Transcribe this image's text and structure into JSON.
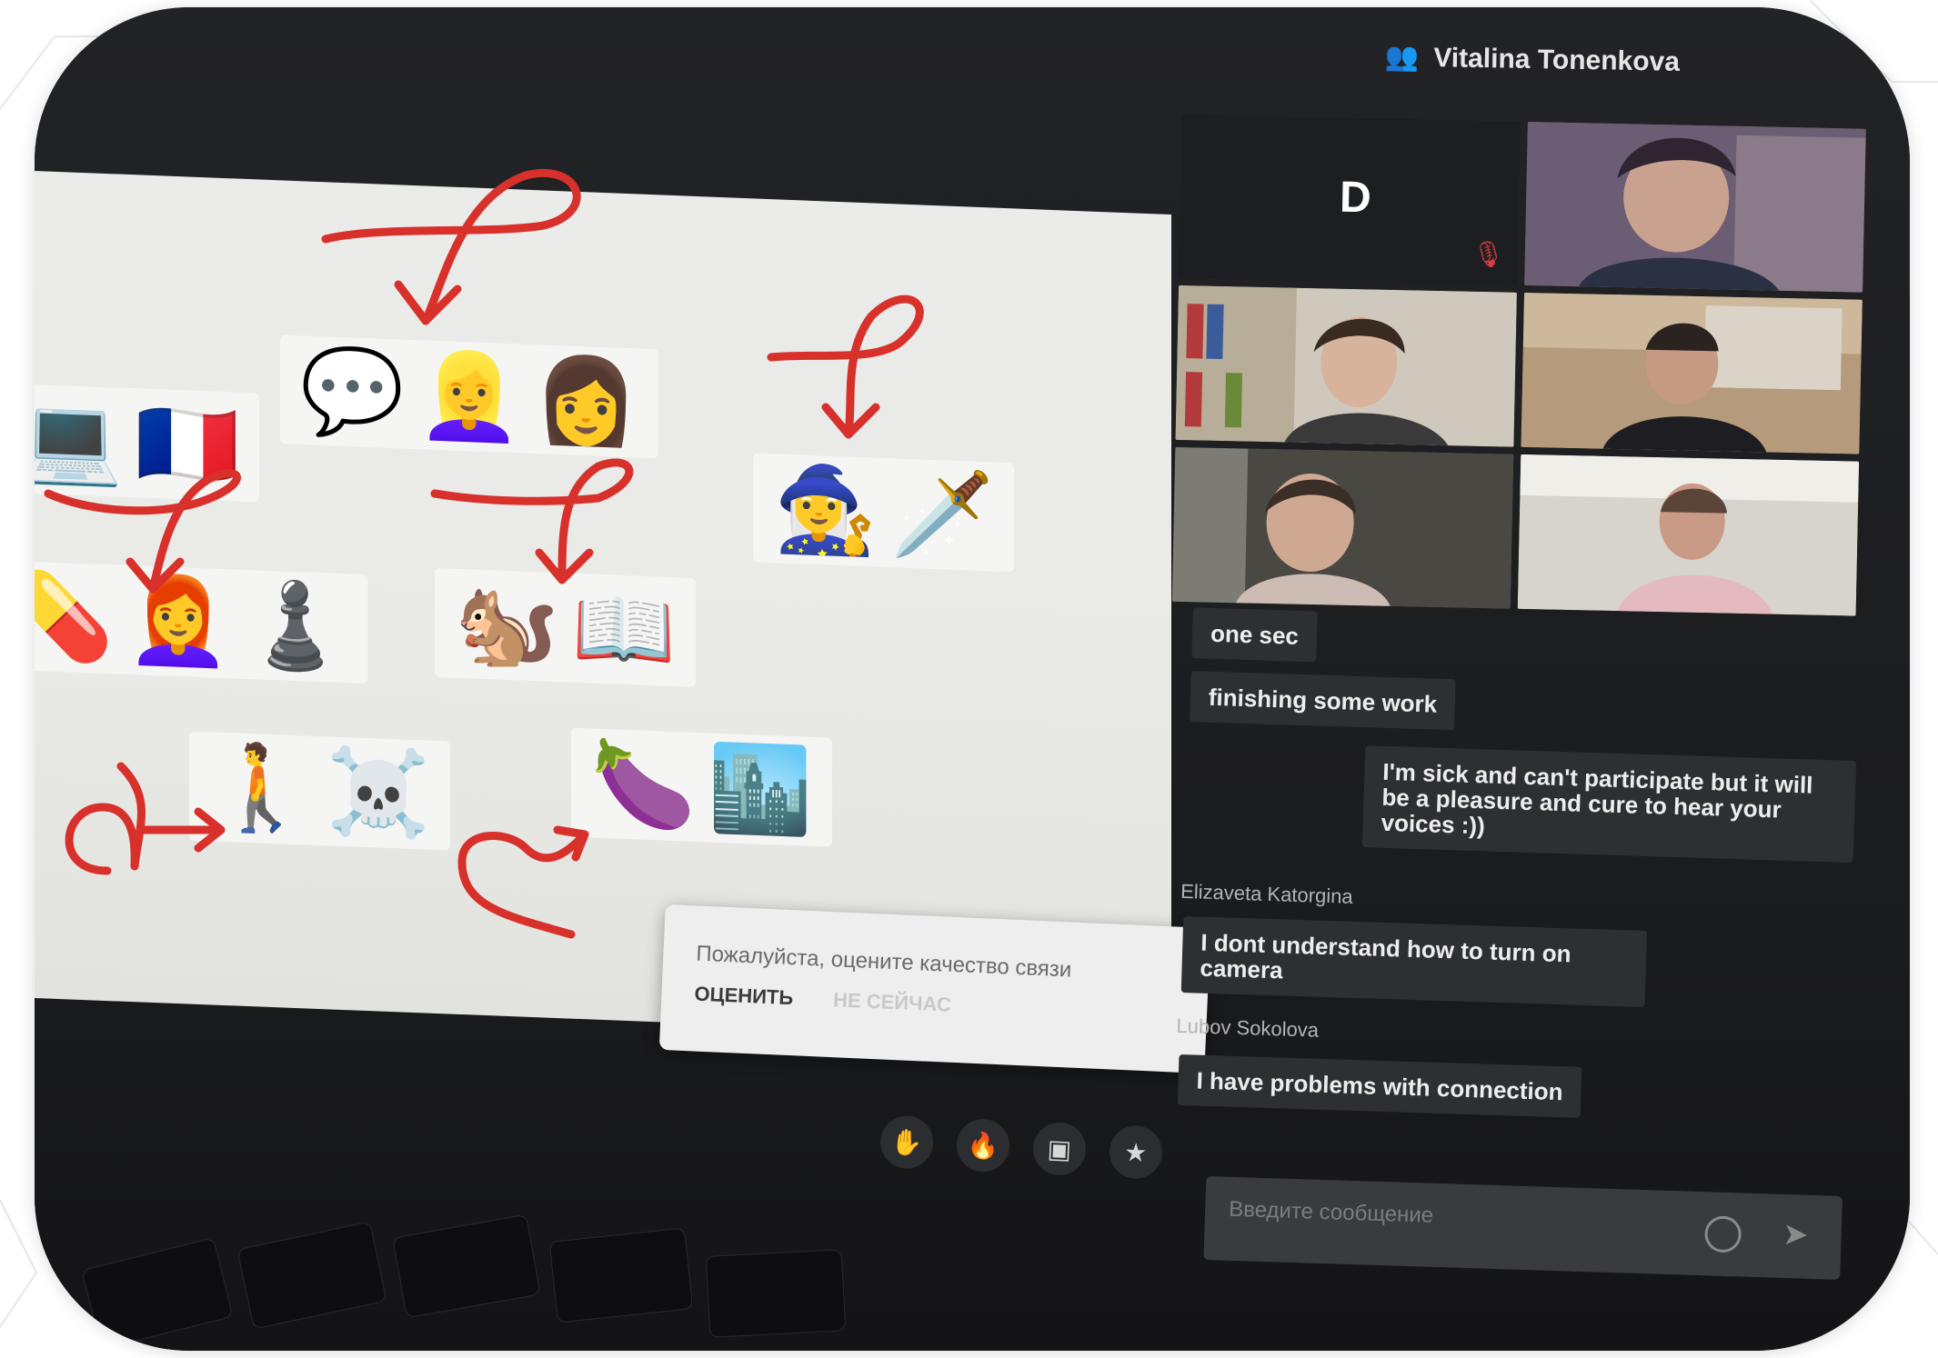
{
  "header": {
    "user_name": "Vitalina Tonenkova",
    "user_icon": "person-add-icon"
  },
  "video_tiles": [
    {
      "kind": "avatar",
      "initial": "D",
      "muted": true,
      "mic_icon": "mic-off-icon"
    },
    {
      "kind": "video"
    },
    {
      "kind": "video"
    },
    {
      "kind": "video"
    },
    {
      "kind": "video"
    },
    {
      "kind": "video"
    }
  ],
  "chat": {
    "messages": [
      {
        "text": "one sec"
      },
      {
        "text": "finishing some work"
      },
      {
        "text": "I'm sick and can't participate but it will be a pleasure and cure to hear your voices :))"
      }
    ],
    "sender_1": "Elizaveta Katorgina",
    "message_4": "I dont understand how to turn on camera",
    "sender_2": "Lubov Sokolova",
    "message_5": "I have problems with connection",
    "input_placeholder": "Введите сообщение",
    "emoji_icon": "smile-icon",
    "send_icon": "send-icon"
  },
  "popup": {
    "text": "Пожалуйста, оцените качество связи",
    "rate_label": "ОЦЕНИТЬ",
    "later_label": "НЕ СЕЙЧАС"
  },
  "toolbar": [
    {
      "name": "raise-hand-button",
      "icon": "hand-icon",
      "glyph": "✋"
    },
    {
      "name": "reaction-button",
      "icon": "fire-icon",
      "glyph": "🔥"
    },
    {
      "name": "screen-share-button",
      "icon": "screen-icon",
      "glyph": "▣"
    },
    {
      "name": "rate-button",
      "icon": "star-icon",
      "glyph": "★"
    }
  ],
  "whiteboard": {
    "groups": [
      {
        "emojis": [
          "💬",
          "👱‍♀️",
          "👩"
        ]
      },
      {
        "emojis": [
          "💻",
          "🇫🇷"
        ]
      },
      {
        "emojis": [
          "🧙‍♀️",
          "🗡️"
        ]
      },
      {
        "emojis": [
          "💊",
          "👩‍🦰",
          "♟️"
        ]
      },
      {
        "emojis": [
          "🐿️",
          "📖"
        ]
      },
      {
        "emojis": [
          "🚶",
          "☠️"
        ]
      },
      {
        "emojis": [
          "🍆",
          "🏙️"
        ]
      }
    ]
  },
  "colors": {
    "accent_red": "#d8302a",
    "panel": "#1d1e21",
    "bubble": "#2e2f32"
  }
}
